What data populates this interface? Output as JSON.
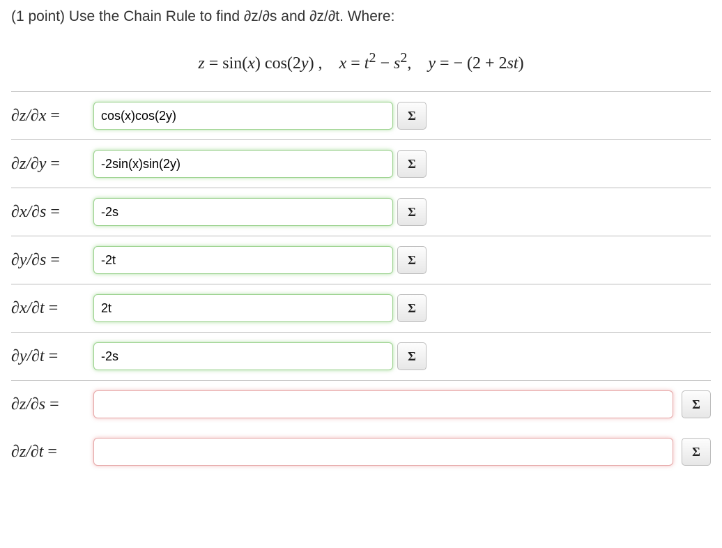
{
  "prompt": "(1 point) Use the Chain Rule to find ∂z/∂s and ∂z/∂t. Where:",
  "equation_display": "z = sin(x) cos(2y) ,    x = t² − s²,    y = − (2 + 2st)",
  "sigma": "Σ",
  "rows": [
    {
      "label_html": "∂z/∂x =",
      "value": "cos(x)cos(2y)",
      "state": "green",
      "width": "short"
    },
    {
      "label_html": "∂z/∂y =",
      "value": "-2sin(x)sin(2y)",
      "state": "green",
      "width": "short"
    },
    {
      "label_html": "∂x/∂s =",
      "value": "-2s",
      "state": "green",
      "width": "short"
    },
    {
      "label_html": "∂y/∂s =",
      "value": "-2t",
      "state": "green",
      "width": "short"
    },
    {
      "label_html": "∂x/∂t =",
      "value": "2t",
      "state": "green",
      "width": "short"
    },
    {
      "label_html": "∂y/∂t =",
      "value": "-2s",
      "state": "green",
      "width": "short"
    },
    {
      "label_html": "∂z/∂s =",
      "value": "",
      "state": "red",
      "width": "long"
    },
    {
      "label_html": "∂z/∂t =",
      "value": "",
      "state": "red",
      "width": "long"
    }
  ],
  "labels_pretty": [
    "dz_dx",
    "dz_dy",
    "dx_ds",
    "dy_ds",
    "dx_dt",
    "dy_dt",
    "dz_ds",
    "dz_dt"
  ],
  "chart_data": {
    "type": "table",
    "title": "Chain Rule partial derivatives",
    "given": {
      "z": "sin(x)·cos(2y)",
      "x": "t^2 - s^2",
      "y": "-(2 + 2·s·t)"
    },
    "entries": [
      {
        "derivative": "∂z/∂x",
        "value": "cos(x)·cos(2y)",
        "status": "correct"
      },
      {
        "derivative": "∂z/∂y",
        "value": "-2·sin(x)·sin(2y)",
        "status": "correct"
      },
      {
        "derivative": "∂x/∂s",
        "value": "-2s",
        "status": "correct"
      },
      {
        "derivative": "∂y/∂s",
        "value": "-2t",
        "status": "correct"
      },
      {
        "derivative": "∂x/∂t",
        "value": "2t",
        "status": "correct"
      },
      {
        "derivative": "∂y/∂t",
        "value": "-2s",
        "status": "correct"
      },
      {
        "derivative": "∂z/∂s",
        "value": "",
        "status": "blank"
      },
      {
        "derivative": "∂z/∂t",
        "value": "",
        "status": "blank"
      }
    ]
  }
}
